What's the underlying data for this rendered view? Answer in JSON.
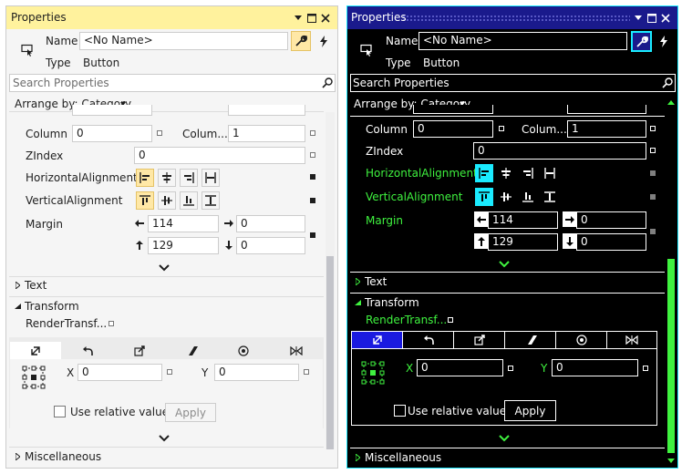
{
  "light": {
    "title": "Properties",
    "name_label": "Name",
    "name_value": "<No Name>",
    "type_label": "Type",
    "type_value": "Button",
    "search_placeholder": "Search Properties",
    "arrange_label": "Arrange by: Category",
    "column_label": "Column",
    "column_value": "0",
    "columnspan_label": "Colum...",
    "columnspan_value": "1",
    "zindex_label": "ZIndex",
    "zindex_value": "0",
    "halign_label": "HorizontalAlignment",
    "valign_label": "VerticalAlignment",
    "margin_label": "Margin",
    "margin_left": "114",
    "margin_right": "0",
    "margin_top": "129",
    "margin_bottom": "0",
    "text_section": "Text",
    "transform_section": "Transform",
    "render_transform_label": "RenderTransf...",
    "x_label": "X",
    "x_value": "0",
    "y_label": "Y",
    "y_value": "0",
    "relative_label": "Use relative values",
    "apply_label": "Apply",
    "misc_section": "Miscellaneous",
    "scroll_thumb_fraction": 0.42
  },
  "dark": {
    "title": "Properties",
    "name_label": "Name",
    "name_value": "<No Name>",
    "type_label": "Type",
    "type_value": "Button",
    "search_placeholder": "Search Properties",
    "arrange_label": "Arrange by: Category",
    "column_label": "Column",
    "column_value": "0",
    "columnspan_label": "Colum...",
    "columnspan_value": "1",
    "zindex_label": "ZIndex",
    "zindex_value": "0",
    "halign_label": "HorizontalAlignment",
    "valign_label": "VerticalAlignment",
    "margin_label": "Margin",
    "margin_left": "114",
    "margin_right": "0",
    "margin_top": "129",
    "margin_bottom": "0",
    "text_section": "Text",
    "transform_section": "Transform",
    "render_transform_label": "RenderTransf...",
    "x_label": "X",
    "x_value": "0",
    "y_label": "Y",
    "y_value": "0",
    "relative_label": "Use relative values",
    "apply_label": "Apply",
    "misc_section": "Miscellaneous",
    "scroll_thumb_fraction": 0.62
  },
  "colors": {
    "light_title_bg": "#fff29d",
    "light_selected_button": "#ffe8a6",
    "dark_title_bg": "#1a1a8c",
    "dark_accent_cyan": "#1aebff",
    "dark_label_green": "#3ff23f",
    "dark_selected_tab": "#1a1ae0"
  },
  "icons": [
    "pin-icon",
    "maximize-icon",
    "close-icon",
    "pointer-icon",
    "wrench-icon",
    "lightning-icon",
    "search-icon",
    "dropdown-caret-icon",
    "align-left-icon",
    "align-center-icon",
    "align-right-icon",
    "align-stretch-icon",
    "align-top-icon",
    "align-vcenter-icon",
    "align-bottom-icon",
    "align-vstretch-icon",
    "arrow-left-icon",
    "arrow-right-icon",
    "arrow-up-icon",
    "arrow-down-icon",
    "chevron-down-icon",
    "triangle-right-icon",
    "triangle-down-icon",
    "translate-icon",
    "rotate-icon",
    "scale-icon",
    "skew-icon",
    "center-point-icon",
    "flip-icon",
    "anchor-grid-icon"
  ]
}
